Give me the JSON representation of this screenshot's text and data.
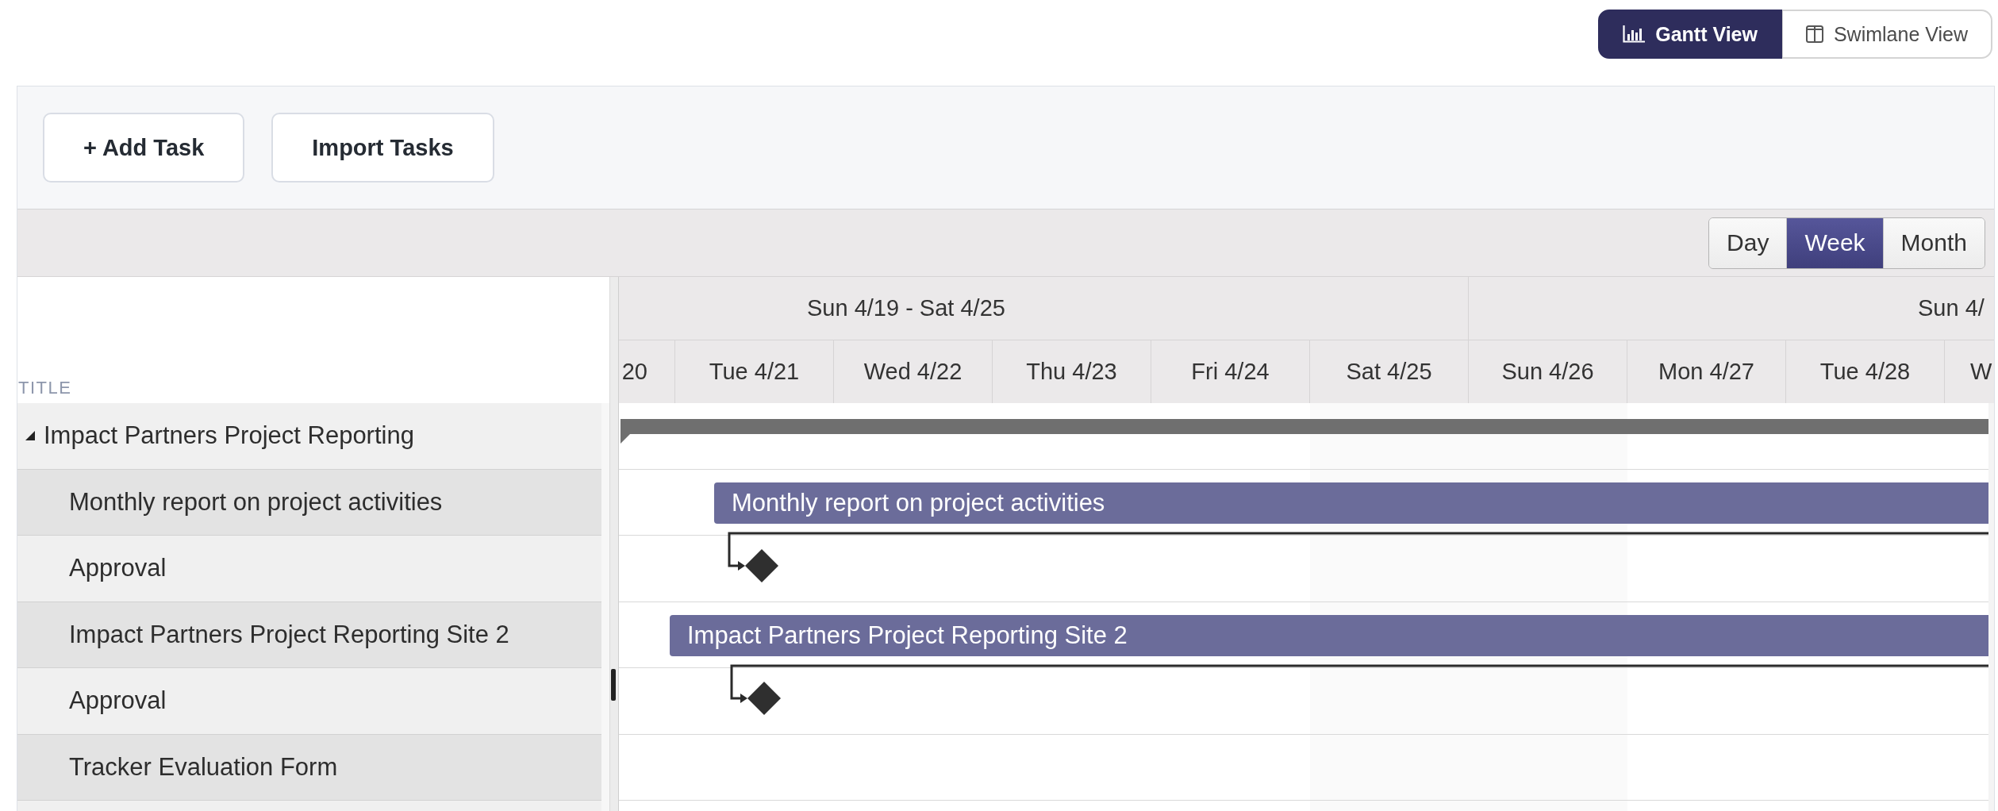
{
  "view_switch": [
    {
      "kind": "gantt",
      "label": "Gantt View",
      "selected": true
    },
    {
      "kind": "swimlane",
      "label": "Swimlane View",
      "selected": false
    }
  ],
  "toolbar": {
    "buttons": [
      "+ Add Task",
      "Import Tasks"
    ]
  },
  "scale_switch": [
    {
      "label": "Day",
      "selected": false
    },
    {
      "label": "Week",
      "selected": true
    },
    {
      "label": "Month",
      "selected": false
    }
  ],
  "task_list": {
    "column_header": "TITLE",
    "rows": [
      {
        "title": "Impact Partners Project Reporting",
        "expanded": true,
        "children": [
          {
            "title": "Monthly report on project activities"
          },
          {
            "title": "Approval"
          },
          {
            "title": "Impact Partners Project Reporting Site 2"
          },
          {
            "title": "Approval"
          },
          {
            "title": "Tracker Evaluation Form"
          }
        ]
      }
    ]
  },
  "timeline": {
    "weeks": [
      "Sun 4/19 - Sat 4/25",
      "Sun 4/"
    ],
    "days": [
      "20",
      "Tue 4/21",
      "Wed 4/22",
      "Thu 4/23",
      "Fri 4/24",
      "Sat 4/25",
      "Sun 4/26",
      "Mon 4/27",
      "Tue 4/28",
      "W"
    ],
    "rows": [
      {
        "kind": "summary"
      },
      {
        "kind": "task",
        "label": "Monthly report on project activities"
      },
      {
        "kind": "milestone"
      },
      {
        "kind": "task",
        "label": "Impact Partners Project Reporting Site 2"
      },
      {
        "kind": "milestone"
      },
      {
        "kind": "empty"
      }
    ]
  }
}
